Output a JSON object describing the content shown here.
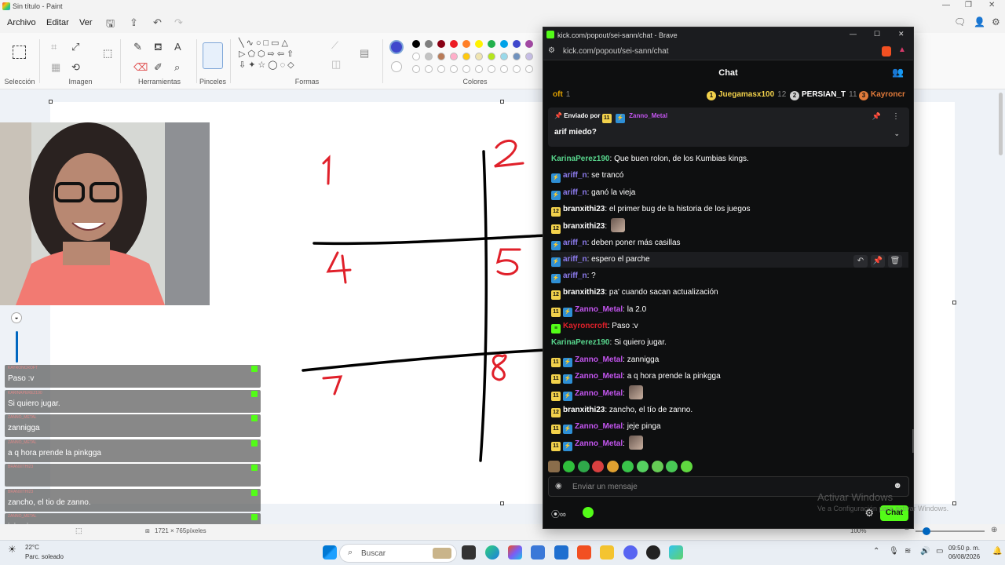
{
  "paint": {
    "window_title": "Sin título - Paint",
    "menu": [
      "Archivo",
      "Editar",
      "Ver"
    ],
    "groups": {
      "selection": "Selección",
      "image": "Imagen",
      "tools": "Herramientas",
      "brushes": "Pinceles",
      "shapes": "Formas",
      "colors": "Colores"
    },
    "palette": [
      "#000000",
      "#7f7f7f",
      "#880015",
      "#ed1c24",
      "#ff7f27",
      "#fff200",
      "#22b14c",
      "#00a2e8",
      "#3f48cc",
      "#a349a4",
      "#ffffff",
      "#c3c3c3",
      "#b97a57",
      "#ffaec9",
      "#ffc90e",
      "#efe4b0",
      "#b5e61d",
      "#99d9ea",
      "#7092be",
      "#c8bfe7"
    ],
    "canvas_size_text": "1721 × 765píxeles",
    "zoom_text": "100%",
    "drawn_numbers": [
      "1",
      "2",
      "4",
      "5",
      "7",
      "8"
    ]
  },
  "stream_overlay": {
    "messages": [
      {
        "user": "KAYRONCROFT",
        "text": "Paso :v"
      },
      {
        "user": "KARINAPEREZ190",
        "text": "Si quiero jugar."
      },
      {
        "user": "ZANNO_METAL",
        "text": "zannigga"
      },
      {
        "user": "ZANNO_METAL",
        "text": "a q hora prende la pinkgga"
      },
      {
        "user": "BRANXITHI23",
        "text": ""
      },
      {
        "user": "BRANXITHI23",
        "text": "zancho, el tio de zanno."
      },
      {
        "user": "ZANNO_METAL",
        "text": "jeje pinga"
      },
      {
        "user": "ZANNO_METAL",
        "text": ""
      }
    ]
  },
  "weather": {
    "temp": "22°C",
    "desc": "Parc. soleado"
  },
  "taskbar": {
    "search_label": "Buscar",
    "time": "09:50 p. m.",
    "date": "06/08/2026"
  },
  "brave": {
    "window_title": "kick.com/popout/sei-sann/chat - Brave",
    "url": "kick.com/popout/sei-sann/chat",
    "chat_title": "Chat",
    "leaderboard": [
      {
        "rank": "",
        "name": "oft",
        "count": "1",
        "color": "#e0a000"
      },
      {
        "rank": "1",
        "name": "Juegamasx100",
        "count": "12",
        "color": "#f2d14b"
      },
      {
        "rank": "2",
        "name": "PERSIAN_T",
        "count": "11",
        "color": "#d0d0d0"
      },
      {
        "rank": "3",
        "name": "Kayroncr",
        "count": "",
        "color": "#e07a3a"
      }
    ],
    "pinned": {
      "label": "Enviado por",
      "sub_months": "11",
      "user": "Zanno_Metal",
      "text": "arif miedo?"
    },
    "messages": [
      {
        "badges": [],
        "user": "KarinaPerez190",
        "color": "#58d68d",
        "text": "Que buen rolon, de los Kumbias kings.",
        "emote": false
      },
      {
        "badges": [
          "kick"
        ],
        "user": "ariff_n",
        "color": "#8e7cf0",
        "text": "se trancó",
        "emote": false
      },
      {
        "badges": [
          "kick"
        ],
        "user": "ariff_n",
        "color": "#8e7cf0",
        "text": "ganó la vieja",
        "emote": false
      },
      {
        "badges": [
          "12"
        ],
        "user": "branxithi23",
        "color": "#ffffff",
        "text": "el primer bug de la historia de los juegos",
        "emote": false
      },
      {
        "badges": [
          "12"
        ],
        "user": "branxithi23",
        "color": "#ffffff",
        "text": "",
        "emote": true
      },
      {
        "badges": [
          "kick"
        ],
        "user": "ariff_n",
        "color": "#8e7cf0",
        "text": "deben poner más casillas",
        "emote": false
      },
      {
        "badges": [
          "kick"
        ],
        "user": "ariff_n",
        "color": "#8e7cf0",
        "text": "espero el parche",
        "emote": false
      },
      {
        "badges": [
          "kick"
        ],
        "user": "ariff_n",
        "color": "#8e7cf0",
        "text": "?",
        "emote": false
      },
      {
        "badges": [
          "12"
        ],
        "user": "branxithi23",
        "color": "#ffffff",
        "text": "pa' cuando sacan actualización",
        "emote": false
      },
      {
        "badges": [
          "11",
          "kick"
        ],
        "user": "Zanno_Metal",
        "color": "#c455f0",
        "text": "la 2.0",
        "emote": false
      },
      {
        "badges": [
          "green"
        ],
        "user": "Kayroncroft",
        "color": "#e0202a",
        "text": "Paso :v",
        "emote": false
      },
      {
        "badges": [],
        "user": "KarinaPerez190",
        "color": "#58d68d",
        "text": "Si quiero jugar.",
        "emote": false
      },
      {
        "badges": [
          "11",
          "kick"
        ],
        "user": "Zanno_Metal",
        "color": "#c455f0",
        "text": "zannigga",
        "emote": false
      },
      {
        "badges": [
          "11",
          "kick"
        ],
        "user": "Zanno_Metal",
        "color": "#c455f0",
        "text": "a q hora prende la pinkgga",
        "emote": false
      },
      {
        "badges": [
          "11",
          "kick"
        ],
        "user": "Zanno_Metal",
        "color": "#c455f0",
        "text": "",
        "emote": true
      },
      {
        "badges": [
          "12"
        ],
        "user": "branxithi23",
        "color": "#ffffff",
        "text": "zancho, el tío de zanno.",
        "emote": false
      },
      {
        "badges": [
          "11",
          "kick"
        ],
        "user": "Zanno_Metal",
        "color": "#c455f0",
        "text": "jeje pinga",
        "emote": false
      },
      {
        "badges": [
          "11",
          "kick"
        ],
        "user": "Zanno_Metal",
        "color": "#c455f0",
        "text": "",
        "emote": true
      }
    ],
    "emote_colors": [
      "#8a6d4b",
      "#2fbf3c",
      "#2fa84a",
      "#d84040",
      "#e0a030",
      "#39c44a",
      "#55d060",
      "#66cc55",
      "#48c855",
      "#60d840"
    ],
    "input_placeholder": "Enviar un mensaje",
    "send_button": "Chat"
  },
  "watermark": {
    "title": "Activar Windows",
    "subtitle": "Ve a Configuración para activar Windows."
  }
}
